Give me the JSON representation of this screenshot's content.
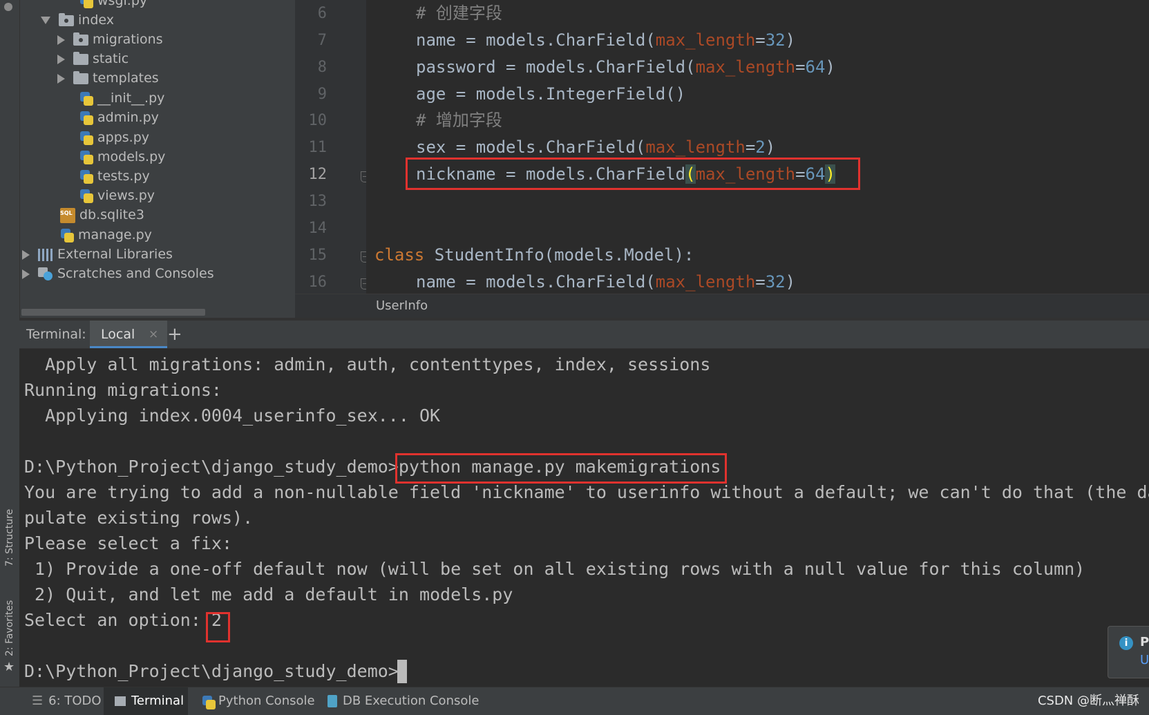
{
  "project_tree": {
    "items": [
      {
        "label": "wsgi.py"
      },
      {
        "label": "index"
      },
      {
        "label": "migrations"
      },
      {
        "label": "static"
      },
      {
        "label": "templates"
      },
      {
        "label": "__init__.py"
      },
      {
        "label": "admin.py"
      },
      {
        "label": "apps.py"
      },
      {
        "label": "models.py"
      },
      {
        "label": "tests.py"
      },
      {
        "label": "views.py"
      },
      {
        "label": "db.sqlite3"
      },
      {
        "label": "manage.py"
      },
      {
        "label": "External Libraries"
      },
      {
        "label": "Scratches and Consoles"
      }
    ]
  },
  "left_strip": {
    "structure": "7: Structure",
    "favorites": "2: Favorites"
  },
  "editor": {
    "line_numbers": [
      "6",
      "7",
      "8",
      "9",
      "10",
      "11",
      "12",
      "13",
      "14",
      "15",
      "16"
    ],
    "breadcrumb": "UserInfo",
    "code": {
      "l6_comment": "# 创建字段",
      "l7_a": "name = models.CharField(",
      "l7_p": "max_length",
      "l7_eq": "=",
      "l7_n": "32",
      "l7_e": ")",
      "l8_a": "password = models.CharField(",
      "l8_p": "max_length",
      "l8_eq": "=",
      "l8_n": "64",
      "l8_e": ")",
      "l9": "age = models.IntegerField()",
      "l10_comment": "# 增加字段",
      "l11_a": "sex = models.CharField(",
      "l11_p": "max_length",
      "l11_eq": "=",
      "l11_n": "2",
      "l11_e": ")",
      "l12_a": "nickname = models.CharField",
      "l12_open": "(",
      "l12_p": "max_length",
      "l12_eq": "=",
      "l12_n": "64",
      "l12_close": ")",
      "l15_kw": "class",
      "l15_rest": " StudentInfo(models.Model):",
      "l16_a": "name = models.CharField(",
      "l16_p": "max_length",
      "l16_eq": "=",
      "l16_n": "32",
      "l16_e": ")"
    }
  },
  "terminal": {
    "label": "Terminal:",
    "tab": "Local",
    "close": "×",
    "add": "+",
    "lines": [
      "  Apply all migrations: admin, auth, contenttypes, index, sessions",
      "Running migrations:",
      "  Applying index.0004_userinfo_sex... OK",
      "",
      "D:\\Python_Project\\django_study_demo>python manage.py makemigrations",
      "You are trying to add a non-nullable field 'nickname' to userinfo without a default; we can't do that (the da",
      "pulate existing rows).",
      "Please select a fix:",
      " 1) Provide a one-off default now (will be set on all existing rows with a null value for this column)",
      " 2) Quit, and let me add a default in models.py",
      "Select an option: 2",
      "",
      "D:\\Python_Project\\django_study_demo>"
    ]
  },
  "notification": {
    "icon": "i",
    "text1": "P",
    "text2": "U"
  },
  "bottom_bar": {
    "todo": "6: TODO",
    "terminal": "Terminal",
    "python_console": "Python Console",
    "db_console": "DB Execution Console",
    "watermark": "CSDN @断灬禅酥"
  },
  "colors": {
    "highlight_box": "#e0322e",
    "keyword": "#cc7832",
    "param": "#aa4926",
    "number": "#6897bb"
  }
}
